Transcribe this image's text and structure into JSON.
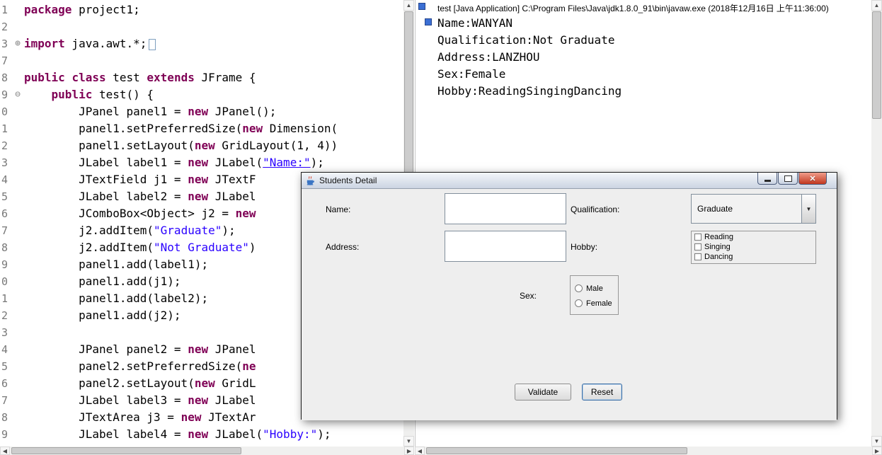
{
  "editor": {
    "lines": [
      {
        "n": "1",
        "f": "",
        "s": [
          [
            "kw",
            "package"
          ],
          [
            "pl",
            " project1;"
          ]
        ]
      },
      {
        "n": "2",
        "f": "",
        "s": []
      },
      {
        "n": "3",
        "f": "plus",
        "s": [
          [
            "kw",
            "import"
          ],
          [
            "pl",
            " java.awt.*;"
          ],
          [
            "box",
            ""
          ]
        ]
      },
      {
        "n": "7",
        "f": "",
        "s": []
      },
      {
        "n": "8",
        "f": "",
        "s": [
          [
            "kw",
            "public"
          ],
          [
            "pl",
            " "
          ],
          [
            "kw",
            "class"
          ],
          [
            "pl",
            " test "
          ],
          [
            "kw",
            "extends"
          ],
          [
            "pl",
            " JFrame {"
          ]
        ]
      },
      {
        "n": "9",
        "f": "minus",
        "s": [
          [
            "pl",
            "    "
          ],
          [
            "kw",
            "public"
          ],
          [
            "pl",
            " test() {"
          ]
        ]
      },
      {
        "n": "0",
        "f": "",
        "s": [
          [
            "pl",
            "        JPanel panel1 = "
          ],
          [
            "kw",
            "new"
          ],
          [
            "pl",
            " JPanel();"
          ]
        ]
      },
      {
        "n": "1",
        "f": "",
        "s": [
          [
            "pl",
            "        panel1.setPreferredSize("
          ],
          [
            "kw",
            "new"
          ],
          [
            "pl",
            " Dimension("
          ]
        ]
      },
      {
        "n": "2",
        "f": "",
        "s": [
          [
            "pl",
            "        panel1.setLayout("
          ],
          [
            "kw",
            "new"
          ],
          [
            "pl",
            " GridLayout(1, 4))"
          ]
        ]
      },
      {
        "n": "3",
        "f": "",
        "s": [
          [
            "pl",
            "        JLabel label1 = "
          ],
          [
            "kw",
            "new"
          ],
          [
            "pl",
            " JLabel("
          ],
          [
            "stru",
            "\"Name:\""
          ],
          [
            "pl",
            ");"
          ]
        ]
      },
      {
        "n": "4",
        "f": "",
        "s": [
          [
            "pl",
            "        JTextField j1 = "
          ],
          [
            "kw",
            "new"
          ],
          [
            "pl",
            " JTextF"
          ]
        ]
      },
      {
        "n": "5",
        "f": "",
        "s": [
          [
            "pl",
            "        JLabel label2 = "
          ],
          [
            "kw",
            "new"
          ],
          [
            "pl",
            " JLabel"
          ]
        ]
      },
      {
        "n": "6",
        "f": "",
        "s": [
          [
            "pl",
            "        JComboBox<Object> j2 = "
          ],
          [
            "kw",
            "new"
          ]
        ]
      },
      {
        "n": "7",
        "f": "",
        "s": [
          [
            "pl",
            "        j2.addItem("
          ],
          [
            "str",
            "\"Graduate\""
          ],
          [
            "pl",
            ");"
          ]
        ]
      },
      {
        "n": "8",
        "f": "",
        "s": [
          [
            "pl",
            "        j2.addItem("
          ],
          [
            "str",
            "\"Not Graduate\""
          ],
          [
            "pl",
            ")"
          ]
        ]
      },
      {
        "n": "9",
        "f": "",
        "s": [
          [
            "pl",
            "        panel1.add(label1);"
          ]
        ]
      },
      {
        "n": "0",
        "f": "",
        "s": [
          [
            "pl",
            "        panel1.add(j1);"
          ]
        ]
      },
      {
        "n": "1",
        "f": "",
        "s": [
          [
            "pl",
            "        panel1.add(label2);"
          ]
        ]
      },
      {
        "n": "2",
        "f": "",
        "s": [
          [
            "pl",
            "        panel1.add(j2);"
          ]
        ]
      },
      {
        "n": "3",
        "f": "",
        "s": []
      },
      {
        "n": "4",
        "f": "",
        "s": [
          [
            "pl",
            "        JPanel panel2 = "
          ],
          [
            "kw",
            "new"
          ],
          [
            "pl",
            " JPanel"
          ]
        ]
      },
      {
        "n": "5",
        "f": "",
        "s": [
          [
            "pl",
            "        panel2.setPreferredSize("
          ],
          [
            "kw",
            "ne"
          ]
        ]
      },
      {
        "n": "6",
        "f": "",
        "s": [
          [
            "pl",
            "        panel2.setLayout("
          ],
          [
            "kw",
            "new"
          ],
          [
            "pl",
            " GridL"
          ]
        ]
      },
      {
        "n": "7",
        "f": "",
        "s": [
          [
            "pl",
            "        JLabel label3 = "
          ],
          [
            "kw",
            "new"
          ],
          [
            "pl",
            " JLabel"
          ]
        ]
      },
      {
        "n": "8",
        "f": "",
        "s": [
          [
            "pl",
            "        JTextArea j3 = "
          ],
          [
            "kw",
            "new"
          ],
          [
            "pl",
            " JTextAr"
          ]
        ]
      },
      {
        "n": "9",
        "f": "",
        "s": [
          [
            "pl",
            "        JLabel label4 = "
          ],
          [
            "kw",
            "new"
          ],
          [
            "pl",
            " JLabel("
          ],
          [
            "str",
            "\"Hobby:\""
          ],
          [
            "pl",
            ");"
          ]
        ]
      }
    ]
  },
  "console": {
    "header": "test [Java Application] C:\\Program Files\\Java\\jdk1.8.0_91\\bin\\javaw.exe (2018年12月16日 上午11:36:00)",
    "output": [
      "Name:WANYAN",
      "Qualification:Not Graduate",
      "Address:LANZHOU",
      "Sex:Female",
      "Hobby:ReadingSingingDancing"
    ]
  },
  "dialog": {
    "title": "Students Detail",
    "name_label": "Name:",
    "name_value": "",
    "qualification_label": "Qualification:",
    "qualification_value": "Graduate",
    "address_label": "Address:",
    "address_value": "",
    "hobby_label": "Hobby:",
    "hobby_options": [
      "Reading",
      "Singing",
      "Dancing"
    ],
    "sex_label": "Sex:",
    "sex_options": [
      "Male",
      "Female"
    ],
    "validate_label": "Validate",
    "reset_label": "Reset"
  },
  "colors": {
    "keyword": "#7f0055",
    "string": "#2a00ff",
    "dialog_bg": "#eeeeee",
    "close_button": "#c2371e",
    "marker_blue": "#3b6fd4"
  },
  "icons": {
    "scroll_up": "▲",
    "scroll_down": "▼",
    "scroll_left": "◀",
    "scroll_right": "▶",
    "combo_arrow": "▼",
    "close": "✕",
    "fold_plus": "⊕",
    "fold_minus": "⊖"
  }
}
